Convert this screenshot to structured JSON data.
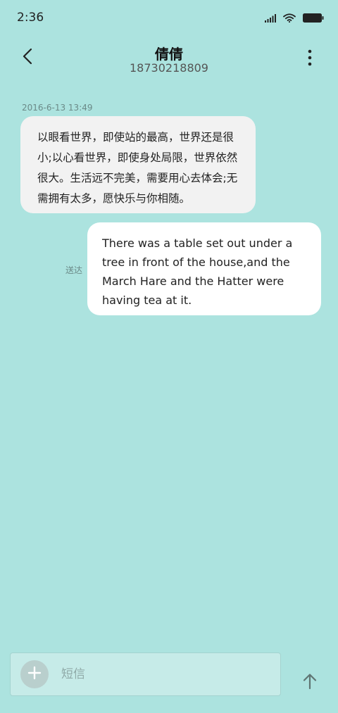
{
  "status_bar": {
    "time": "2:36",
    "icons": [
      "signal-icon",
      "wifi-icon",
      "battery-icon"
    ]
  },
  "header": {
    "title": "倩倩",
    "subtitle": "18730218809",
    "back_icon": "chevron-left-icon",
    "more_icon": "more-vertical-icon"
  },
  "conversation": {
    "timestamp": "2016-6-13 13:49",
    "messages": [
      {
        "direction": "incoming",
        "text": "以眼看世界，即使站的最高，世界还是很小;以心看世界，即使身处局限，世界依然很大。生活远不完美，需要用心去体会;无需拥有太多，愿快乐与你相随。"
      },
      {
        "direction": "outgoing",
        "text": "There was a table set out under a tree in front of the house,and the March Hare and the Hatter were having tea at it.",
        "status": "送达"
      }
    ]
  },
  "composer": {
    "placeholder": "短信",
    "value": "",
    "add_icon": "plus-icon",
    "send_icon": "arrow-up-icon"
  },
  "colors": {
    "background": "#ace3df",
    "incoming_bubble": "#f2f2f2",
    "outgoing_bubble": "#ffffff",
    "compose_bg": "#c6ebe8"
  }
}
